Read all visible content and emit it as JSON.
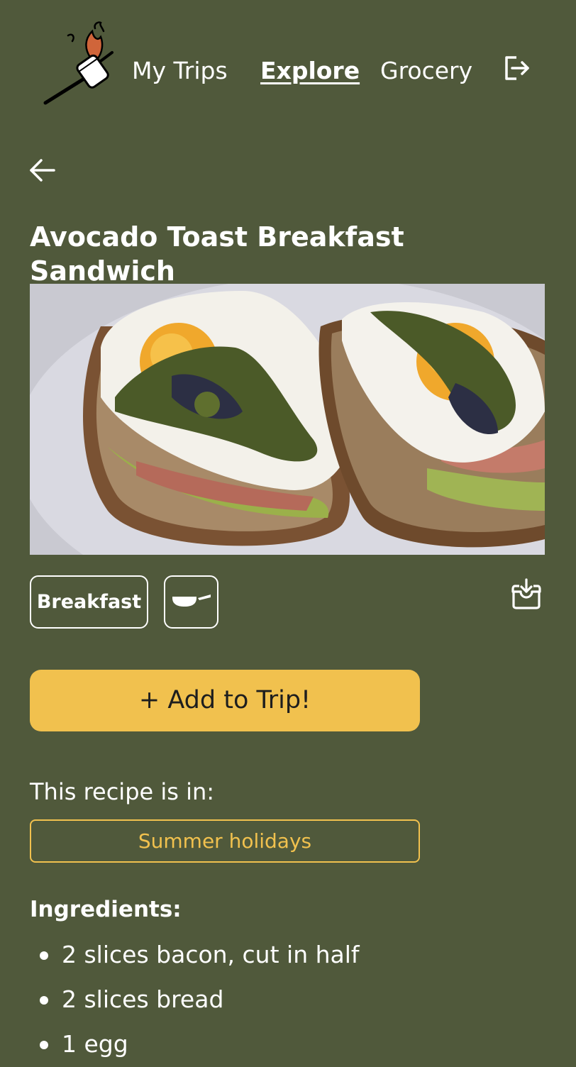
{
  "nav": {
    "logo_icon": "marshmallow-on-stick-logo",
    "links": [
      "My Trips",
      "Explore",
      "Grocery"
    ],
    "active_link": "Explore",
    "logout_icon": "logout-icon"
  },
  "recipe": {
    "back_icon": "arrow-left-icon",
    "title": "Avocado Toast Breakfast Sandwich",
    "image_subject": "avocado toast with fried egg, bacon and pesto",
    "meal_tag": "Breakfast",
    "cookware_icon": "frying-pan-icon",
    "save_icon": "download-tray-icon",
    "add_button": "+ Add to Trip!",
    "in_label": "This recipe is in:",
    "trips": [
      "Summer holidays"
    ],
    "ingredients_title": "Ingredients:",
    "ingredients": [
      "2 slices bacon, cut in half",
      "2 slices bread",
      "1 egg"
    ]
  },
  "colors": {
    "background": "#50593b",
    "accent": "#f1c14e",
    "text": "#ffffff"
  }
}
